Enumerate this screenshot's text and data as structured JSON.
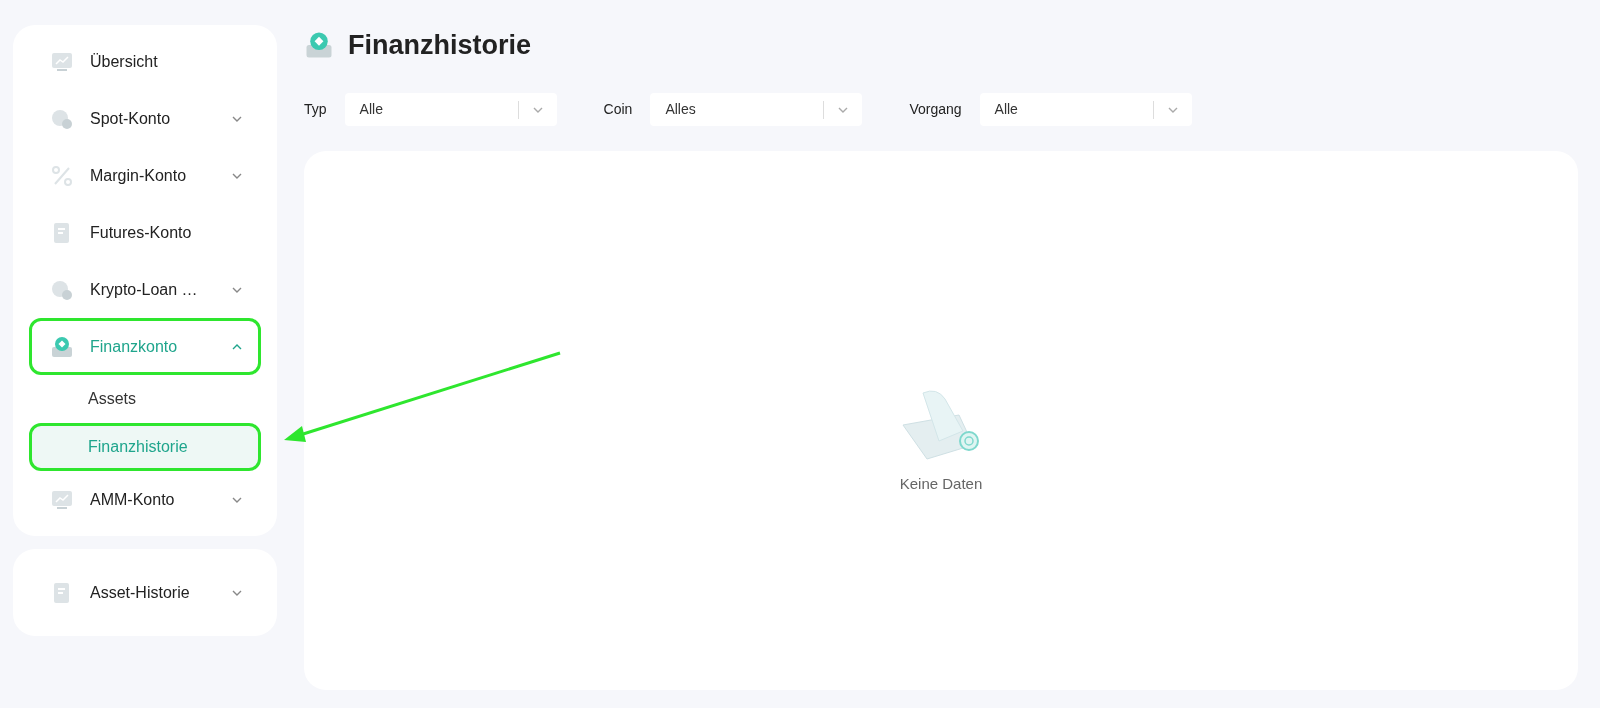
{
  "sidebar": {
    "groups": [
      {
        "items": [
          {
            "kind": "link",
            "label": "Übersicht",
            "selected": false,
            "highlighted": false
          },
          {
            "kind": "group",
            "label": "Spot-Konto",
            "selected": false,
            "expanded": false,
            "highlighted": false
          },
          {
            "kind": "group",
            "label": "Margin-Konto",
            "selected": false,
            "expanded": false,
            "highlighted": false
          },
          {
            "kind": "link",
            "label": "Futures-Konto",
            "selected": false,
            "highlighted": false
          },
          {
            "kind": "group",
            "label": "Krypto-Loan …",
            "selected": false,
            "expanded": false,
            "highlighted": false
          },
          {
            "kind": "group",
            "label": "Finanzkonto",
            "selected": true,
            "expanded": true,
            "highlighted": true,
            "children": [
              {
                "label": "Assets",
                "selected": false,
                "highlighted": false
              },
              {
                "label": "Finanzhistorie",
                "selected": true,
                "highlighted": true
              }
            ]
          },
          {
            "kind": "group",
            "label": "AMM-Konto",
            "selected": false,
            "expanded": false,
            "highlighted": false
          }
        ]
      },
      {
        "items": [
          {
            "kind": "group",
            "label": "Asset-Historie",
            "selected": false,
            "expanded": false,
            "highlighted": false
          }
        ]
      }
    ]
  },
  "page": {
    "title": "Finanzhistorie"
  },
  "filters": [
    {
      "label": "Typ",
      "value": "Alle"
    },
    {
      "label": "Coin",
      "value": "Alles"
    },
    {
      "label": "Vorgang",
      "value": "Alle"
    }
  ],
  "empty_state": {
    "text": "Keine Daten"
  },
  "annotation_arrow": true
}
